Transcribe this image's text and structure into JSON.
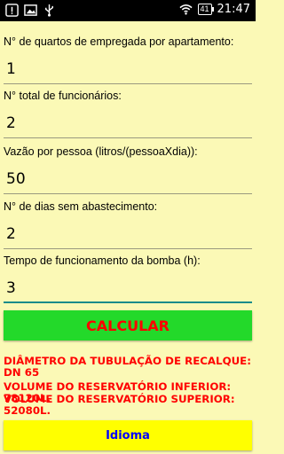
{
  "status_bar": {
    "time": "21:47",
    "battery": "41",
    "left_icons": [
      "warning-icon",
      "image-icon",
      "usb-icon"
    ],
    "right_icons": [
      "wifi-icon",
      "battery-icon"
    ]
  },
  "form": {
    "fields": [
      {
        "label": "N° de quartos de empregada por apartamento:",
        "value": "1"
      },
      {
        "label": "N° total de funcionários:",
        "value": "2"
      },
      {
        "label": "Vazão por pessoa (litros/(pessoaXdia)):",
        "value": "50"
      },
      {
        "label": "N° de dias sem abastecimento:",
        "value": "2"
      },
      {
        "label": "Tempo de funcionamento da bomba (h):",
        "value": "3"
      }
    ]
  },
  "calculate_label": "CALCULAR",
  "results": {
    "pipe_diameter": "DIÂMETRO DA TUBULAÇÃO DE RECALQUE: DN 65",
    "lower_reservoir": "VOLUME DO RESERVATÓRIO INFERIOR: 78120L.",
    "upper_reservoir": "VOLUME DO RESERVATÓRIO SUPERIOR: 52080L."
  },
  "language_label": "Idioma",
  "colors": {
    "background": "#fbf9b6",
    "calc_button": "#23d92a",
    "calc_text": "#ff0000",
    "result_text": "#ff0000",
    "lang_button": "#ffff00",
    "lang_text": "#0000ff"
  }
}
